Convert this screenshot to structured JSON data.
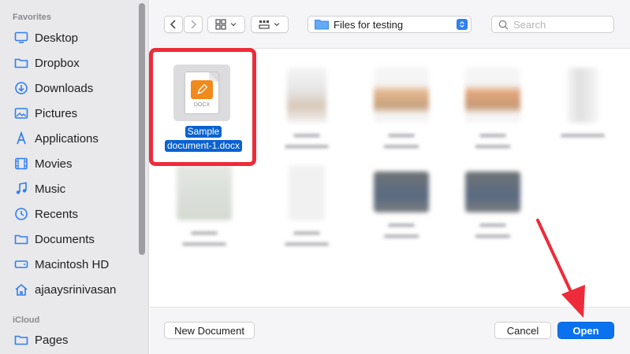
{
  "sidebar": {
    "favorites_label": "Favorites",
    "icloud_label": "iCloud",
    "items": [
      {
        "label": "Desktop",
        "icon": "desktop-icon"
      },
      {
        "label": "Dropbox",
        "icon": "folder-icon"
      },
      {
        "label": "Downloads",
        "icon": "download-icon"
      },
      {
        "label": "Pictures",
        "icon": "pictures-icon"
      },
      {
        "label": "Applications",
        "icon": "applications-icon"
      },
      {
        "label": "Movies",
        "icon": "movies-icon"
      },
      {
        "label": "Music",
        "icon": "music-icon"
      },
      {
        "label": "Recents",
        "icon": "clock-icon"
      },
      {
        "label": "Documents",
        "icon": "folder-icon"
      },
      {
        "label": "Macintosh HD",
        "icon": "disk-icon"
      },
      {
        "label": "ajaaysrinivasan",
        "icon": "home-icon"
      }
    ],
    "icloud_items": [
      {
        "label": "Pages",
        "icon": "folder-icon"
      }
    ]
  },
  "toolbar": {
    "location": "Files for testing",
    "search_placeholder": "Search"
  },
  "files": {
    "selected": {
      "line1": "Sample",
      "line2": "document-1.docx",
      "ext": "DOCX"
    }
  },
  "footer": {
    "new_document": "New Document",
    "cancel": "Cancel",
    "open": "Open"
  },
  "colors": {
    "accent": "#0a72ee",
    "selection": "#0a62d0",
    "highlight_box": "#ee2b3a",
    "docx_badge": "#f08a1c"
  }
}
